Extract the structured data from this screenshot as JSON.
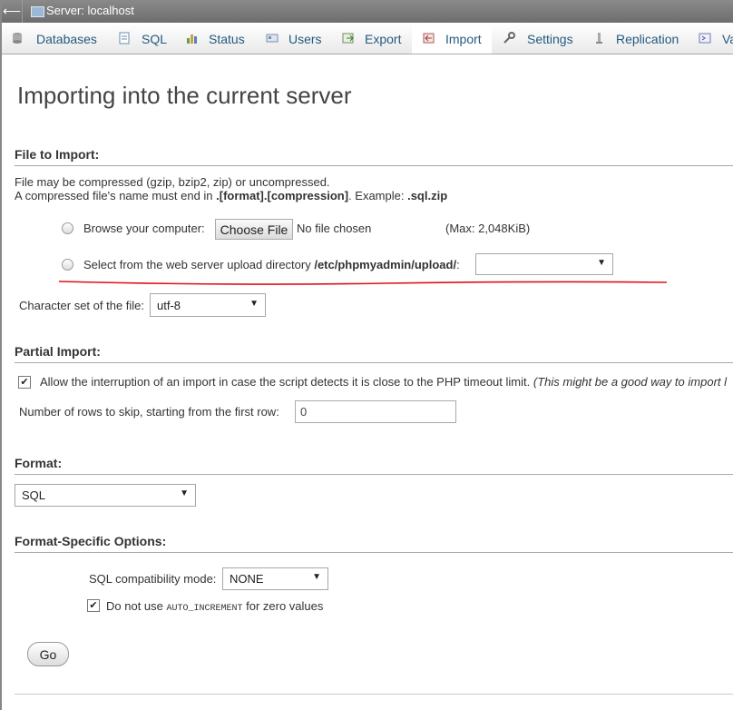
{
  "window": {
    "back_glyph": "⟵",
    "title": "Server: localhost"
  },
  "tabs": [
    {
      "label": "Databases",
      "icon": "databases-icon"
    },
    {
      "label": "SQL",
      "icon": "sql-icon"
    },
    {
      "label": "Status",
      "icon": "status-icon"
    },
    {
      "label": "Users",
      "icon": "users-icon"
    },
    {
      "label": "Export",
      "icon": "export-icon"
    },
    {
      "label": "Import",
      "icon": "import-icon",
      "active": true
    },
    {
      "label": "Settings",
      "icon": "settings-icon"
    },
    {
      "label": "Replication",
      "icon": "replication-icon"
    },
    {
      "label": "Va",
      "icon": "variables-icon"
    }
  ],
  "page": {
    "title": "Importing into the current server"
  },
  "file_to_import": {
    "heading": "File to Import:",
    "note1": "File may be compressed (gzip, bzip2, zip) or uncompressed.",
    "note2_a": "A compressed file's name must end in ",
    "note2_b": ".[format].[compression]",
    "note2_c": ". Example: ",
    "note2_d": ".sql.zip",
    "browse_label": "Browse your computer:",
    "choose_file_label": "Choose File",
    "no_file_text": "No file chosen",
    "max_text": "(Max: 2,048KiB)",
    "upload_dir_label_a": "Select from the web server upload directory ",
    "upload_dir_label_b": "/etc/phpmyadmin/upload/",
    "upload_dir_label_c": ":",
    "upload_dir_value": "",
    "charset_label": "Character set of the file:",
    "charset_value": "utf-8"
  },
  "partial_import": {
    "heading": "Partial Import:",
    "allow_interrupt_text": "Allow the interruption of an import in case the script detects it is close to the PHP timeout limit.",
    "allow_interrupt_note": "(This might be a good way to import l",
    "allow_interrupt_checked": true,
    "skip_rows_label": "Number of rows to skip, starting from the first row:",
    "skip_rows_value": "0"
  },
  "format": {
    "heading": "Format:",
    "value": "SQL"
  },
  "format_options": {
    "heading": "Format-Specific Options:",
    "compat_label": "SQL compatibility mode:",
    "compat_value": "NONE",
    "no_auto_inc_a": "Do not use ",
    "no_auto_inc_b": "AUTO_INCREMENT",
    "no_auto_inc_c": " for zero values",
    "no_auto_inc_checked": true
  },
  "actions": {
    "go_label": "Go"
  },
  "colors": {
    "link": "#235a81",
    "annotation": "#e0101a"
  }
}
